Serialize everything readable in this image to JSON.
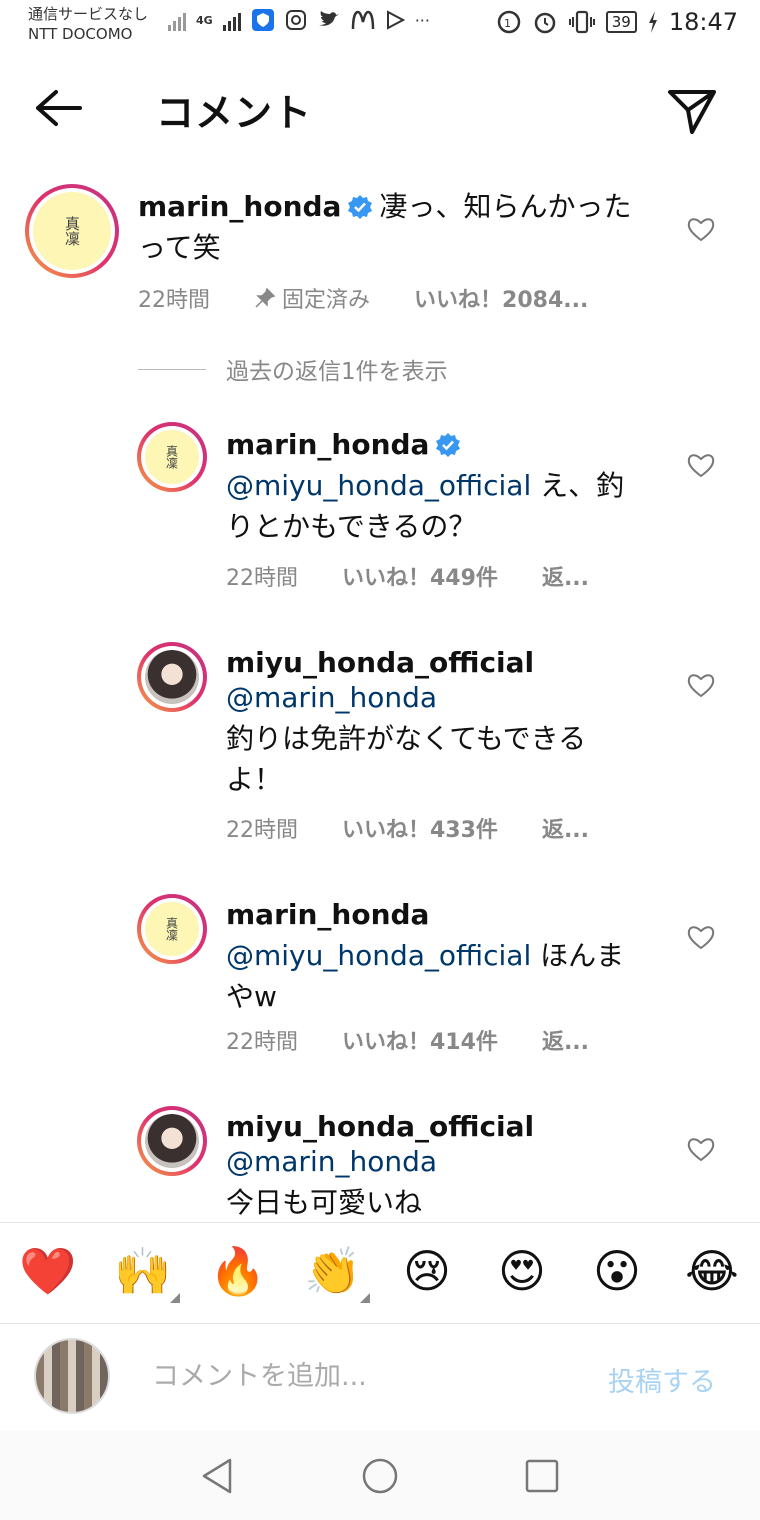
{
  "status_bar": {
    "carrier_line1": "通信サービスなし",
    "carrier_line2": "NTT DOCOMO",
    "network": "4G",
    "battery": "39",
    "time": "18:47"
  },
  "header": {
    "title": "コメント"
  },
  "pinned_comment": {
    "username": "marin_honda",
    "avatar_text": "真凜",
    "text": "凄っ、知らんかったって笑",
    "time": "22時間",
    "pinned_label": "固定済み",
    "likes": "いいね！2084..."
  },
  "view_replies": "過去の返信1件を表示",
  "replies": [
    {
      "username": "marin_honda",
      "avatar_text": "真凜",
      "mention": "@miyu_honda_official",
      "text": "え、釣りとかもできるの？",
      "time": "22時間",
      "likes": "いいね！449件",
      "reply": "返..."
    },
    {
      "username": "miyu_honda_official",
      "mention": "@marin_honda",
      "text": "釣りは免許がなくてもできるよ！",
      "time": "22時間",
      "likes": "いいね！433件",
      "reply": "返..."
    },
    {
      "username": "marin_honda",
      "avatar_text": "真凜",
      "mention": "@miyu_honda_official",
      "text": "ほんまやw",
      "time": "22時間",
      "likes": "いいね！414件",
      "reply": "返..."
    },
    {
      "username": "miyu_honda_official",
      "mention": "@marin_honda",
      "text": "今日も可愛いね"
    }
  ],
  "emoji_reactions": [
    "❤️",
    "🙌",
    "🔥",
    "👏",
    "😢",
    "😍",
    "😮",
    "😂"
  ],
  "compose": {
    "placeholder": "コメントを追加...",
    "post_label": "投稿する"
  },
  "colors": {
    "verified": "#3897f0",
    "mention": "#00376b",
    "post_disabled": "#a9d3f3",
    "ring_start": "#f7a343",
    "ring_end": "#c13584"
  }
}
